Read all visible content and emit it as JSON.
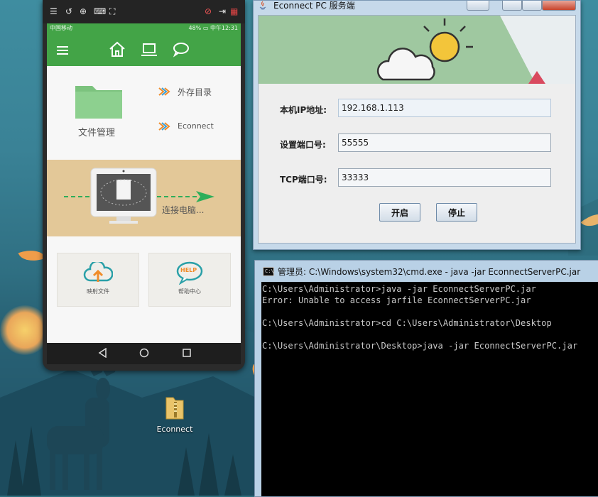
{
  "desktop": {
    "icon_label": "Econnect"
  },
  "phone": {
    "status_bar": {
      "carrier": "中国移动",
      "battery": "48%",
      "time": "中午12:31"
    },
    "app_bar": {
      "icons": [
        "menu-icon",
        "home-icon",
        "laptop-icon",
        "chat-icon"
      ]
    },
    "file_manager_label": "文件管理",
    "links": [
      {
        "label": "外存目录"
      },
      {
        "label": "Econnect"
      }
    ],
    "connect_label": "连接电脑...",
    "tiles": [
      {
        "label": "映射文件",
        "icon": "cloud-upload-icon"
      },
      {
        "label": "帮助中心",
        "icon": "help-icon",
        "badge": "HELP"
      }
    ],
    "nav_bar": {
      "icons": [
        "back-icon",
        "home-circle-icon",
        "recents-icon"
      ]
    }
  },
  "java_window": {
    "title": "Econnect PC 服务端",
    "fields": [
      {
        "label": "本机IP地址:",
        "value": "192.168.1.113"
      },
      {
        "label": "设置端口号:",
        "value": "55555"
      },
      {
        "label": "TCP端口号:",
        "value": "33333"
      }
    ],
    "buttons": {
      "start": "开启",
      "stop": "停止"
    }
  },
  "cmd_window": {
    "title": "管理员: C:\\Windows\\system32\\cmd.exe - java  -jar EconnectServerPC.jar",
    "lines": [
      "C:\\Users\\Administrator>java -jar EconnectServerPC.jar",
      "Error: Unable to access jarfile EconnectServerPC.jar",
      "",
      "C:\\Users\\Administrator>cd C:\\Users\\Administrator\\Desktop",
      "",
      "C:\\Users\\Administrator\\Desktop>java -jar EconnectServerPC.jar"
    ]
  },
  "colors": {
    "app_green": "#43a447",
    "arrow_green": "#2eae5a",
    "banner_green": "#9fc8a0",
    "connect_panel": "#e3c898"
  }
}
